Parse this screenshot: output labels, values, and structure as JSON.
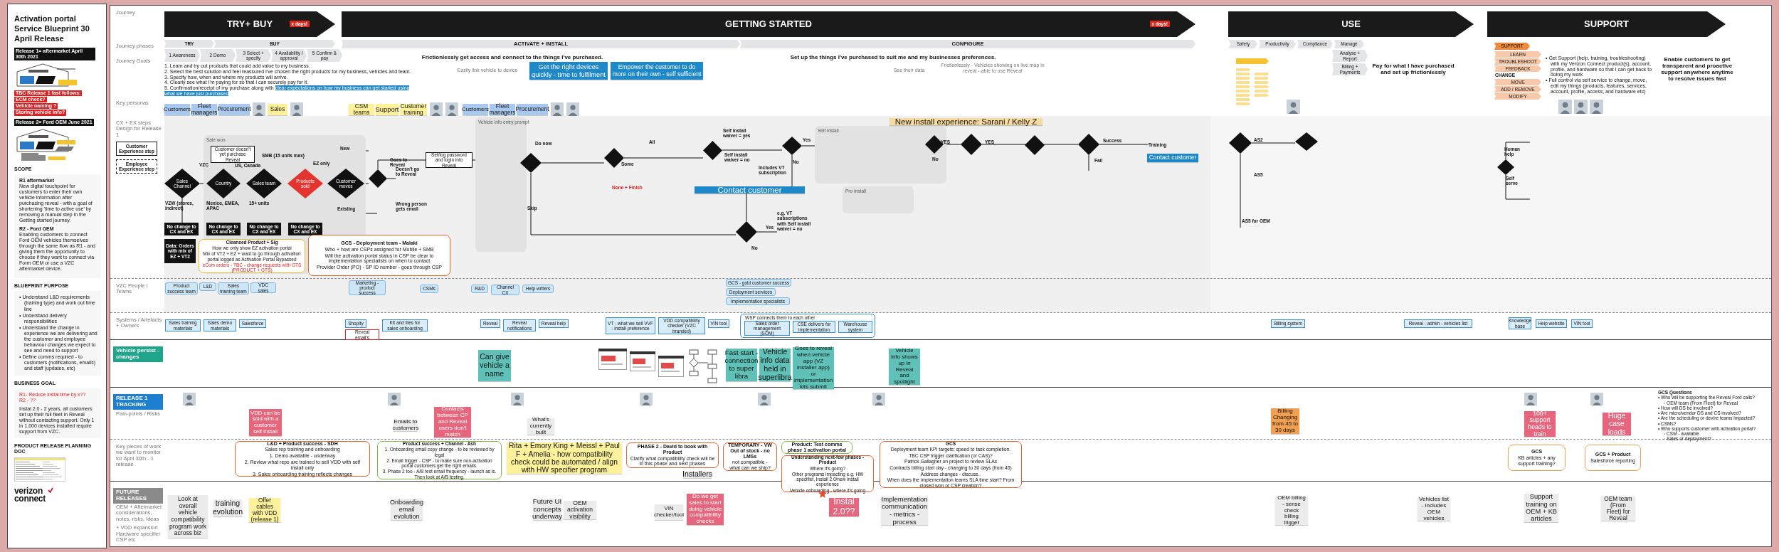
{
  "sidebar": {
    "title": "Activation portal Service Blueprint 30 April Release",
    "release_1": "Release 1= aftermarket April 30th 2021",
    "fast_follows": [
      "TBC Release 1 fast follows:",
      "ECM check?",
      "Vehicle naming ?",
      "Storing vehicle info?"
    ],
    "release_2": "Release 2= Ford OEM June 2021",
    "scope": {
      "heading": "SCOPE",
      "paragraphs": [
        {
          "title": "R1 aftermarket",
          "text": "New digital touchpoint for customers to enter their own vehicle information after purchasing reveal - with a goal of shortening 'time to active use' by removing a manual step in the Getting started journey."
        },
        {
          "title": "R2 - Ford OEM",
          "text": "Enabling customers to connect Ford OEM vehicles themselves through the same flow as R1 - and giving them the opportunity to choose if they want to connect via Form OEM or use a VZC aftermarket device."
        }
      ]
    },
    "purpose": {
      "heading": "BLUEPRINT PURPOSE",
      "bullets": [
        "• Understand L&D requirements (training type) and work out time line",
        "• Understand delivery responsibilities",
        "• Understand the change in experience we are delivering and the customer and employee behaviour changes we expect to see and need to support",
        "• Define comms required - to customers (notifications, emails) and staff (updates, etc)"
      ]
    },
    "goal": {
      "heading": "BUSINESS GOAL",
      "targets": [
        "R1- Reduce instal time by x??",
        "R2 - ??"
      ],
      "text": "Instal 2.0 - 2 years, all customers set up their full fleet in Reveal without contacting support. Only 1 in 1,000 devices installed require support from VZC."
    },
    "doc": {
      "heading": "PRODUCT RELEASE PLANNING DOC"
    },
    "logo": {
      "word": "verizon",
      "sub": "connect"
    }
  },
  "bands": [
    {
      "label": "Journey",
      "items": [
        {
          "kind": "arrow",
          "text": "TRY+ BUY",
          "badge": "x days!"
        },
        {
          "kind": "arrow",
          "text": "GETTING STARTED",
          "badge": "x days!"
        },
        {
          "kind": "arrow",
          "text": "USE"
        },
        {
          "kind": "arrow",
          "text": "SUPPORT"
        }
      ]
    },
    {
      "label": "Journey phases",
      "items": [
        {
          "kind": "phase",
          "text": "TRY"
        },
        {
          "kind": "phase",
          "text": "BUY"
        },
        {
          "kind": "phase",
          "text": "ACTIVATE + INSTALL"
        },
        {
          "kind": "phase",
          "text": "CONFIGURE"
        },
        {
          "kind": "phase",
          "text": "Safety"
        },
        {
          "kind": "phase",
          "text": "Productivity"
        },
        {
          "kind": "phase",
          "text": "Compliance"
        },
        {
          "kind": "phase",
          "text": "Manage"
        },
        {
          "kind": "phase",
          "text": "1 Awareness"
        },
        {
          "kind": "phase",
          "text": "2 Demo"
        },
        {
          "kind": "phase",
          "text": "3 Select + specify"
        },
        {
          "kind": "phase",
          "text": "4 Availability / approval"
        },
        {
          "kind": "phase",
          "text": "5 Confirm & pay"
        }
      ]
    },
    {
      "label": "Journey Goals",
      "items": [
        {
          "kind": "numbered",
          "lines": [
            {
              "text": "1. Learn and try out products that could add value to my business."
            },
            {
              "text": "2. Select the best solution and feel reassured I've chosen the right products for my business, vehicles and team."
            },
            {
              "text": "3. Specify how, when and where my products will arrive."
            },
            {
              "text": "4. Clearly see what I'm paying for so that I can securely pay for it."
            },
            {
              "text": "5. Confirmation/receipt of my purchase along with",
              "highlight": "clear expectations on how my business can get started using what we have just purchased"
            }
          ]
        },
        {
          "kind": "heading",
          "text": "Frictionlessly get access and connect to the things I've purchased."
        },
        {
          "kind": "caption",
          "text": "Easily link vehicle to device"
        },
        {
          "kind": "note",
          "color": "#1e88c9",
          "text": "Get the right devices quickly - time to fulfilment"
        },
        {
          "kind": "note",
          "color": "#1e88c9",
          "text": "Empower the customer to do more on their own - self sufficient"
        },
        {
          "kind": "heading",
          "text": "Set up the things I've purchased to suit me and my businesses preferences."
        },
        {
          "kind": "caption",
          "text": "See their data"
        },
        {
          "kind": "caption",
          "text": "Frictionlessly - Vehicles showing on live map in reveal - able to use Reveal"
        },
        {
          "kind": "usemap"
        },
        {
          "kind": "chevron",
          "color": "#e3e5e8",
          "text": "Analyse + Report"
        },
        {
          "kind": "chevron",
          "color": "#e3e5e8",
          "text": "Billing + Payments"
        },
        {
          "kind": "heading",
          "text": "Pay for what I have purchased and set up frictionlessly"
        },
        {
          "kind": "chevron",
          "color": "#ef8a3e",
          "text": "SUPPORT"
        },
        {
          "kind": "chevron",
          "color": "#f7c8aa",
          "text": "LEARN"
        },
        {
          "kind": "chevron",
          "color": "#f7c8aa",
          "text": "TROUBLESHOOT"
        },
        {
          "kind": "chevron",
          "color": "#f7c8aa",
          "text": "FEEDBACK"
        },
        {
          "kind": "text",
          "text": "CHANGE"
        },
        {
          "kind": "chevron",
          "color": "#f7c8aa",
          "text": "MOVE"
        },
        {
          "kind": "chevron",
          "color": "#f7c8aa",
          "text": "ADD / REMOVE"
        },
        {
          "kind": "chevron",
          "color": "#f7c8aa",
          "text": "MODIFY"
        },
        {
          "kind": "bullets",
          "bullets": [
            {
              "text": "• Get Support (help, training, troubleshooting) with my Verizon Connect product(s), account, profile, and hardware so that I can get back to doing my work"
            },
            {
              "text": "• Full control via self service to change, move, edit my things (products, features, services, account, profile, access, and hardware etc)"
            }
          ]
        },
        {
          "kind": "heading",
          "text": "Enable customers to get transparent and proactive support anywhere anytime to resolve issues fast"
        }
      ]
    },
    {
      "label": "Key personas",
      "items": [
        {
          "kind": "note",
          "color": "#a9c8ee",
          "text": "Customers"
        },
        {
          "kind": "note",
          "color": "#a9c8ee",
          "text": "Fleet managers"
        },
        {
          "kind": "note",
          "color": "#a9c8ee",
          "text": "Procurement"
        },
        {
          "kind": "avatar"
        },
        {
          "kind": "note",
          "color": "#fdf29b",
          "text": "Sales"
        },
        {
          "kind": "avatar"
        },
        {
          "kind": "note",
          "color": "#fdf29b",
          "text": "CSM teams"
        },
        {
          "kind": "note",
          "color": "#fdf29b",
          "text": "Support"
        },
        {
          "kind": "note",
          "color": "#fdf29b",
          "text": "Customer training"
        },
        {
          "kind": "avatar"
        },
        {
          "kind": "avatar"
        },
        {
          "kind": "note",
          "color": "#a9c8ee",
          "text": "Customers"
        },
        {
          "kind": "note",
          "color": "#a9c8ee",
          "text": "Fleet managers"
        },
        {
          "kind": "note",
          "color": "#a9c8ee",
          "text": "Procurement"
        },
        {
          "kind": "avatar"
        },
        {
          "kind": "avatar"
        },
        {
          "kind": "avatar"
        },
        {
          "kind": "avatar"
        },
        {
          "kind": "avatar"
        },
        {
          "kind": "avatar"
        }
      ]
    },
    {
      "label": "CX + EX steps Design for Release 1",
      "legend": [
        "Customer Experience step",
        "Employee Experience step"
      ],
      "items": [
        {
          "kind": "panel",
          "title": "Sale won"
        },
        {
          "kind": "panel",
          "title": "Vehicle info entry prompt"
        },
        {
          "kind": "panel",
          "title": "Self install"
        },
        {
          "kind": "panel",
          "title": "Pro Install"
        },
        {
          "kind": "note",
          "color": "#f7dba0",
          "text": "New install experience: Sarani / Kelly Z"
        },
        {
          "kind": "diamond",
          "flagged": false,
          "text": "Sales Channel"
        },
        {
          "kind": "text",
          "text": "VZW (stores, indirect)"
        },
        {
          "kind": "text",
          "text": "VZC"
        },
        {
          "kind": "box",
          "text": "Customer doesn't yet purchase Reveal"
        },
        {
          "kind": "diamond",
          "flagged": false,
          "text": "Country"
        },
        {
          "kind": "text",
          "text": "US, Canada"
        },
        {
          "kind": "text",
          "text": "Mexico, EMEA, APAC"
        },
        {
          "kind": "text",
          "text": "SMB (15 units max)"
        },
        {
          "kind": "diamond",
          "flagged": false,
          "text": "Sales team"
        },
        {
          "kind": "text",
          "text": "15+ units"
        },
        {
          "kind": "diamond",
          "flagged": true,
          "text": "Products sold"
        },
        {
          "kind": "text",
          "text": "EZ only"
        },
        {
          "kind": "text",
          "text": "New"
        },
        {
          "kind": "diamond",
          "flagged": false,
          "text": "Customer moves"
        },
        {
          "kind": "text",
          "text": "Existing"
        },
        {
          "kind": "darkbox",
          "text": "No change to CX and EX"
        },
        {
          "kind": "darkbox",
          "text": "No change to CX and EX"
        },
        {
          "kind": "darkbox",
          "text": "No change to CX and EX"
        },
        {
          "kind": "darkbox",
          "text": "No change to CX and EX"
        },
        {
          "kind": "darkbox",
          "text": "Data: Orders with mix of EZ + VT2"
        },
        {
          "kind": "outline",
          "color": "#f2b92f",
          "lines": [
            "Cleansed Product + Sig",
            "How we only show EZ activation portal",
            "Mix of VT2 + EZ + want to go through activation portal logged as Activation Portal Bypassed"
          ],
          "alert": "eCom orders - TBC - change requests with GTS (PRODUCT + GTS)"
        },
        {
          "kind": "outline",
          "color": "#e8622c",
          "lines": [
            "GCS - Deployment team - Malaki",
            "Who + how are CSPs assigned for Mobile + SMB",
            "Will the activation portal status in CSP be clear to implementation specialists on when to contact",
            "Provider Order (PO) - SP ID number - goes through CSP"
          ]
        },
        {
          "kind": "diamond",
          "flagged": false
        },
        {
          "kind": "text",
          "text": "Goes to Reveal"
        },
        {
          "kind": "text",
          "text": "Doesn't go to Reveal"
        },
        {
          "kind": "text",
          "text": "Wrong person gets email"
        },
        {
          "kind": "box",
          "text": "Set/log password and login into Reveal"
        },
        {
          "kind": "diamond",
          "flagged": false
        },
        {
          "kind": "text",
          "text": "Do now"
        },
        {
          "kind": "text",
          "text": "Skip"
        },
        {
          "kind": "diamond",
          "flagged": false
        },
        {
          "kind": "text",
          "text": "Some"
        },
        {
          "kind": "alert",
          "text": "None + Finish"
        },
        {
          "kind": "text",
          "text": "All"
        },
        {
          "kind": "diamond",
          "flagged": false
        },
        {
          "kind": "text",
          "text": "Self install waiver = yes"
        },
        {
          "kind": "text",
          "text": "Self install waiver = no"
        },
        {
          "kind": "note",
          "color": "#1e88c9",
          "text": "Contact customer"
        },
        {
          "kind": "diamond",
          "flagged": false
        },
        {
          "kind": "text",
          "text": "Yes"
        },
        {
          "kind": "text",
          "text": "No"
        },
        {
          "kind": "text",
          "text": "Includes VT subscription"
        },
        {
          "kind": "diamond",
          "flagged": false
        },
        {
          "kind": "text",
          "text": "Yes"
        },
        {
          "kind": "text",
          "text": "No"
        },
        {
          "kind": "text",
          "text": "e.g. VT subscriptions with Self install waiver = no"
        },
        {
          "kind": "diamond",
          "flagged": false
        },
        {
          "kind": "text",
          "text": "YES"
        },
        {
          "kind": "text",
          "text": "No"
        },
        {
          "kind": "diamond",
          "flagged": false
        },
        {
          "kind": "text",
          "text": "YES"
        },
        {
          "kind": "diamond",
          "flagged": false
        },
        {
          "kind": "diamond",
          "flagged": false
        },
        {
          "kind": "text",
          "text": "Success"
        },
        {
          "kind": "text",
          "text": "Fail"
        },
        {
          "kind": "text",
          "text": "Training"
        },
        {
          "kind": "note",
          "color": "#1e88c9",
          "text": "Contact customer"
        },
        {
          "kind": "diamond",
          "flagged": false
        },
        {
          "kind": "text",
          "text": "AS2"
        },
        {
          "kind": "diamond",
          "flagged": false
        },
        {
          "kind": "text",
          "text": "AS5"
        },
        {
          "kind": "text",
          "text": "AS5 for OEM"
        },
        {
          "kind": "text",
          "text": "Human help"
        },
        {
          "kind": "diamond",
          "flagged": false
        },
        {
          "kind": "text",
          "text": "Self serve"
        }
      ]
    },
    {
      "label": "VZC People / Teams",
      "items": [
        {
          "kind": "team",
          "text": "Product success team"
        },
        {
          "kind": "team",
          "text": "L&D"
        },
        {
          "kind": "team",
          "text": "Sales training team"
        },
        {
          "kind": "team",
          "text": "VDC sales"
        },
        {
          "kind": "team",
          "text": "Marketing - product success"
        },
        {
          "kind": "team",
          "text": "CSMs"
        },
        {
          "kind": "team",
          "text": "R&D"
        },
        {
          "kind": "team",
          "text": "Channel CX"
        },
        {
          "kind": "team",
          "text": "Help writers"
        },
        {
          "kind": "team",
          "text": "GCS - gold customer success"
        },
        {
          "kind": "team",
          "text": "Deployment services"
        },
        {
          "kind": "team",
          "text": "Implementation specialists"
        }
      ]
    },
    {
      "label": "Systems / Artefacts + Owners",
      "items": [
        {
          "kind": "system",
          "text": "Sales training materials"
        },
        {
          "kind": "system",
          "text": "Sales demo materials"
        },
        {
          "kind": "system",
          "text": "Salesforce"
        },
        {
          "kind": "system",
          "text": "Shopify"
        },
        {
          "kind": "alertbox",
          "text": "Reveal email's"
        },
        {
          "kind": "system",
          "text": "Kit and tiles for sales onboarding"
        },
        {
          "kind": "system",
          "text": "Reveal"
        },
        {
          "kind": "system",
          "text": "Reveal notifications"
        },
        {
          "kind": "system",
          "text": "Reveal help"
        },
        {
          "kind": "system",
          "text": "VT - what we sell VVF - install preference"
        },
        {
          "kind": "system",
          "text": "VDD compatibility checker (VZC branded)"
        },
        {
          "kind": "system",
          "text": "VIN tool"
        },
        {
          "kind": "group",
          "title": "WSP connects them to each other"
        },
        {
          "kind": "system",
          "text": "Sales order management (SOM)"
        },
        {
          "kind": "system",
          "text": "CSE delivers for implementation"
        },
        {
          "kind": "system",
          "text": "Warehouse system"
        },
        {
          "kind": "system",
          "text": "Billing system"
        },
        {
          "kind": "system",
          "text": "Reveal - admin - vehicles list"
        },
        {
          "kind": "system",
          "text": "Knowledge base"
        },
        {
          "kind": "system",
          "text": "Help website"
        },
        {
          "kind": "system",
          "text": "VIN tool"
        }
      ]
    },
    {
      "label": "Vehicle persist - changes",
      "color": "#1fa58b",
      "items": [
        {
          "kind": "note",
          "color": "#5fc1b7",
          "text": "Can give vehicle a name"
        },
        {
          "kind": "thumbnail"
        },
        {
          "kind": "flowmini"
        },
        {
          "kind": "note",
          "color": "#5fc1b7",
          "text": "Fast start - connection to super libra"
        },
        {
          "kind": "note",
          "color": "#5fc1b7",
          "text": "Vehicle info data held in superlibra"
        },
        {
          "kind": "note",
          "color": "#5fc1b7",
          "text": "Goes to reveal when vehicle app (VZ installer app) or implementation kits submit"
        },
        {
          "kind": "note",
          "color": "#5fc1b7",
          "text": "Vehicle info shows up in Reveal and spotlight"
        }
      ]
    },
    {
      "label": "RELEASE 1 TRACKING",
      "color": "#1e7fd0",
      "items": [
        {
          "kind": "avatar"
        },
        {
          "kind": "avatar"
        },
        {
          "kind": "avatar"
        },
        {
          "kind": "avatar"
        },
        {
          "kind": "avatar"
        },
        {
          "kind": "avatar"
        },
        {
          "kind": "avatar"
        },
        {
          "kind": "avatar"
        },
        {
          "kind": "bullets",
          "heading": "GCS Questions",
          "bullets": [
            {
              "text": "• Who will be supporting the Reveal Ford calls?",
              "children": [
                {
                  "text": "◦ OEM team (From Fleet) for Reveal"
                }
              ]
            },
            {
              "text": "• How will DS be involved?"
            },
            {
              "text": "• Are micro/vendor DS and CS involved?"
            },
            {
              "text": "• Are the scheduling or dev/re teams impacted?"
            },
            {
              "text": "• CSMs?"
            },
            {
              "text": "• Who supports customer with activation portal?",
              "children": [
                {
                  "text": "◦ CSM - available"
                },
                {
                  "text": "◦ Sales or deployment?"
                }
              ]
            }
          ]
        }
      ]
    },
    {
      "label": "Pain-points / Risks",
      "items": [
        {
          "kind": "note",
          "color": "#e6667d",
          "text": "VDD can be sold with a customer self install"
        },
        {
          "kind": "note",
          "color": "#ececec",
          "text": "Emails to customers"
        },
        {
          "kind": "note",
          "color": "#e6667d",
          "text": "Contacts between CP and Reveal users don't match"
        },
        {
          "kind": "note",
          "color": "#ececec",
          "text": "What's currently built"
        },
        {
          "kind": "note",
          "color": "#f0a050",
          "text": "Billing Changing from 45 to 30 days"
        },
        {
          "kind": "note",
          "color": "#e6667d",
          "text": "100+ support heads to train"
        },
        {
          "kind": "note",
          "color": "#e6667d",
          "text": "Huge case loads"
        }
      ]
    },
    {
      "label": "Key pieces of work we want to monitor for April 30th - 1 release",
      "items": [
        {
          "kind": "outline",
          "color": "#e8622c",
          "lines": [
            "L&D + Product success - SDH",
            "Sales rep training and onboarding",
            "1. Demo available - underway",
            "2. Review what reps are trained to sell VDD with self install only",
            "3. Sales onboarding training reflects changes"
          ]
        },
        {
          "kind": "outline",
          "color": "#7cbf3f",
          "lines": [
            "Product success + Channel - Ash",
            "1. Onboarding email copy change - to be reviewed by legal",
            "2. Email trigger - CSP - to make sure non-activation portal customers get the right emails.",
            "3. Phase 2 too - A/B test email frequency - launch as is. Then look at A/B testing."
          ]
        },
        {
          "kind": "note",
          "color": "#fdf29b",
          "text": "Rita + Emory King + Meissl + Paul F + Amelia - how compatibility check could be automated / align with HW specifier program"
        },
        {
          "kind": "outline",
          "color": "#e8622c",
          "lines": [
            "PHASE 2 - David to book with Product",
            "Clarify what compatibility check will be in this phase and next phases"
          ]
        },
        {
          "kind": "note",
          "color": "#ececec",
          "text": "Installers"
        },
        {
          "kind": "outline",
          "color": "#e8622c",
          "lines": [
            "TEMPORARY - VW Out of stock - no LMSs",
            "not compatible - what can we ship?"
          ]
        },
        {
          "kind": "outline",
          "color": "#7cbf3f",
          "lines": [
            "Product: Test comms phase 1 activation portal"
          ]
        },
        {
          "kind": "outline",
          "color": "#e8622c",
          "lines": [
            "Understanding next-few phases - Product",
            "Where it's going?",
            "Other programs impacting e.g. HW specifier, Install 2.0/new install experience",
            "Vehicle onboarding - where it's going"
          ]
        },
        {
          "kind": "outline",
          "color": "#e8622c",
          "lines": [
            "GCS",
            "Deployment team KPI targets: speed to task completion.",
            "TBC CSP trigger clarification (or CAS)?",
            "Patrick Gallagher on project to review SLAs",
            "Contracts billing start day - changing to 30 days (from 45)",
            "Address changes - discuss..",
            "When does the implementation teams SLA time start? From closed won or CSP creation?"
          ]
        },
        {
          "kind": "outline",
          "color": "#f0a050",
          "lines": [
            "GCS",
            "KB articles + any support training?"
          ]
        },
        {
          "kind": "outline",
          "color": "#f0a050",
          "lines": [
            "GCS + Product",
            "Salesforce reporting"
          ]
        }
      ]
    },
    {
      "label": "FUTURE RELEASES",
      "color": "#8a8a8a"
    },
    {
      "label": "OEM + Aftermarket considerations, notes, risks, Ideas",
      "extra": "+ VDD expansion Hardware specifier CSP etc",
      "items": [
        {
          "kind": "note",
          "color": "#ececec",
          "text": "Look at overall vehicle compatibility program work across biz"
        },
        {
          "kind": "note",
          "color": "#ececec",
          "text": "training evolution"
        },
        {
          "kind": "note",
          "color": "#fdf29b",
          "text": "Offer cables with VDD (release 1)"
        },
        {
          "kind": "note",
          "color": "#ececec",
          "text": "Onboarding email evolution"
        },
        {
          "kind": "note",
          "color": "#ececec",
          "text": "Future UI concepts underway"
        },
        {
          "kind": "note",
          "color": "#ececec",
          "text": "OEM activation visibility"
        },
        {
          "kind": "note",
          "color": "#ececec",
          "text": "VIN checker/tool"
        },
        {
          "kind": "note",
          "color": "#e6667d",
          "text": "Do we get sales to start doing vehicle compatibility checks"
        },
        {
          "kind": "star"
        },
        {
          "kind": "note",
          "color": "#e6667d",
          "text": "Instal 2.0??"
        },
        {
          "kind": "note",
          "color": "#ececec",
          "text": "Implementation communication - metrics - process"
        },
        {
          "kind": "note",
          "color": "#ececec",
          "text": "OEM billing - sense check billing trigger"
        },
        {
          "kind": "note",
          "color": "#ececec",
          "text": "Vehicles list - includes OEM vehicles"
        },
        {
          "kind": "note",
          "color": "#ececec",
          "text": "Support training on OEM + KB articles"
        },
        {
          "kind": "note",
          "color": "#ececec",
          "text": "OEM team (From Fleet) for Reveal"
        }
      ]
    }
  ]
}
